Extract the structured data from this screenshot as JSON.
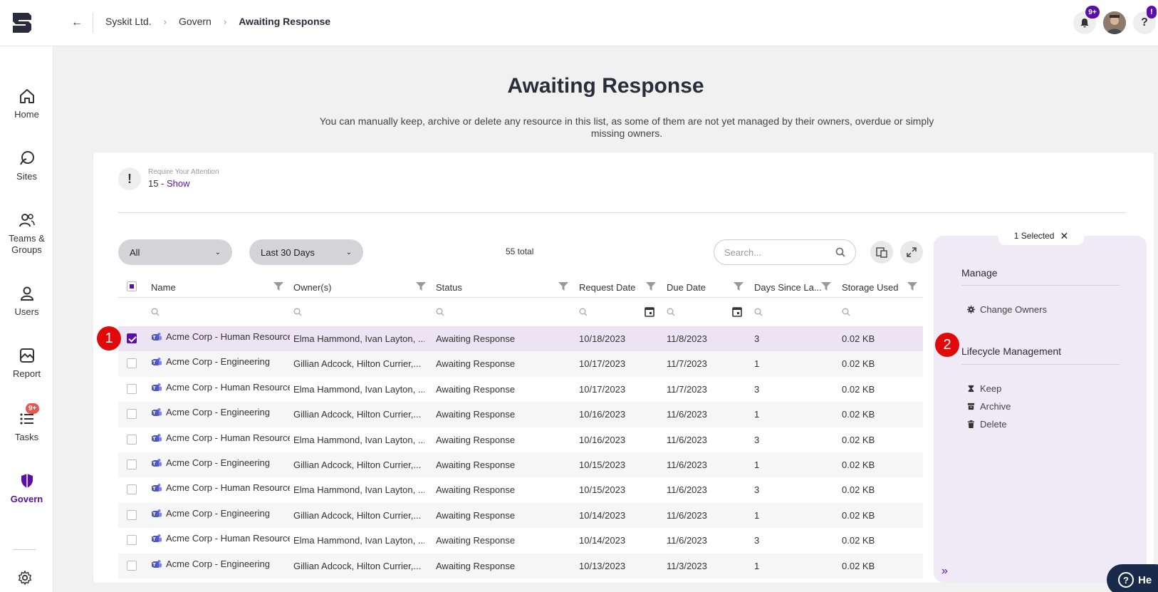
{
  "breadcrumb": [
    "Syskit Ltd.",
    "Govern",
    "Awaiting Response"
  ],
  "topbar": {
    "notification_badge": "9+",
    "help_label": "?",
    "help_badge": "!"
  },
  "sidebar": {
    "items": [
      {
        "label": "Home",
        "icon": "home-icon"
      },
      {
        "label": "Sites",
        "icon": "sites-icon"
      },
      {
        "label": "Teams & Groups",
        "icon": "teams-groups-icon"
      },
      {
        "label": "Users",
        "icon": "user-icon"
      },
      {
        "label": "Report",
        "icon": "report-icon"
      },
      {
        "label": "Tasks",
        "icon": "tasks-icon",
        "badge": "9+"
      },
      {
        "label": "Govern",
        "icon": "shield-icon",
        "active": true
      }
    ]
  },
  "page": {
    "title": "Awaiting Response",
    "description": "You can manually keep, archive or delete any resource in this list, as some of them are not yet managed by their owners, overdue or simply missing owners."
  },
  "attention": {
    "label": "Require Your Attention",
    "count": "15 - ",
    "link": "Show"
  },
  "filters": {
    "status": "All",
    "period": "Last 30 Days",
    "total": "55 total",
    "search_placeholder": "Search..."
  },
  "table": {
    "columns": [
      "Name",
      "Owner(s)",
      "Status",
      "Request Date",
      "Due Date",
      "Days Since La...",
      "Storage Used"
    ],
    "rows": [
      [
        "Acme Corp - Human Resources",
        "Elma Hammond, Ivan Layton, ...",
        "Awaiting Response",
        "10/18/2023",
        "11/8/2023",
        "3",
        "0.02 KB"
      ],
      [
        "Acme Corp - Engineering",
        "Gillian Adcock, Hilton Currier,...",
        "Awaiting Response",
        "10/17/2023",
        "11/7/2023",
        "1",
        "0.02 KB"
      ],
      [
        "Acme Corp - Human Resources",
        "Elma Hammond, Ivan Layton, ...",
        "Awaiting Response",
        "10/17/2023",
        "11/7/2023",
        "3",
        "0.02 KB"
      ],
      [
        "Acme Corp - Engineering",
        "Gillian Adcock, Hilton Currier,...",
        "Awaiting Response",
        "10/16/2023",
        "11/6/2023",
        "1",
        "0.02 KB"
      ],
      [
        "Acme Corp - Human Resources",
        "Elma Hammond, Ivan Layton, ...",
        "Awaiting Response",
        "10/16/2023",
        "11/6/2023",
        "3",
        "0.02 KB"
      ],
      [
        "Acme Corp - Engineering",
        "Gillian Adcock, Hilton Currier,...",
        "Awaiting Response",
        "10/15/2023",
        "11/6/2023",
        "1",
        "0.02 KB"
      ],
      [
        "Acme Corp - Human Resources",
        "Elma Hammond, Ivan Layton, ...",
        "Awaiting Response",
        "10/15/2023",
        "11/6/2023",
        "3",
        "0.02 KB"
      ],
      [
        "Acme Corp - Engineering",
        "Gillian Adcock, Hilton Currier,...",
        "Awaiting Response",
        "10/14/2023",
        "11/6/2023",
        "1",
        "0.02 KB"
      ],
      [
        "Acme Corp - Human Resources",
        "Elma Hammond, Ivan Layton, ...",
        "Awaiting Response",
        "10/14/2023",
        "11/6/2023",
        "3",
        "0.02 KB"
      ],
      [
        "Acme Corp - Engineering",
        "Gillian Adcock, Hilton Currier,...",
        "Awaiting Response",
        "10/13/2023",
        "11/3/2023",
        "1",
        "0.02 KB"
      ]
    ],
    "selected_row": 0
  },
  "panel": {
    "selected": "1 Selected",
    "manage_title": "Manage",
    "change_owners": "Change Owners",
    "lifecycle_title": "Lifecycle Management",
    "keep": "Keep",
    "archive": "Archive",
    "delete": "Delete"
  },
  "markers": [
    "1",
    "2"
  ],
  "help_fab": "He",
  "colors": {
    "accent": "#5b0fa8",
    "marker": "#e10a0a",
    "panel": "#f0e9f6"
  }
}
